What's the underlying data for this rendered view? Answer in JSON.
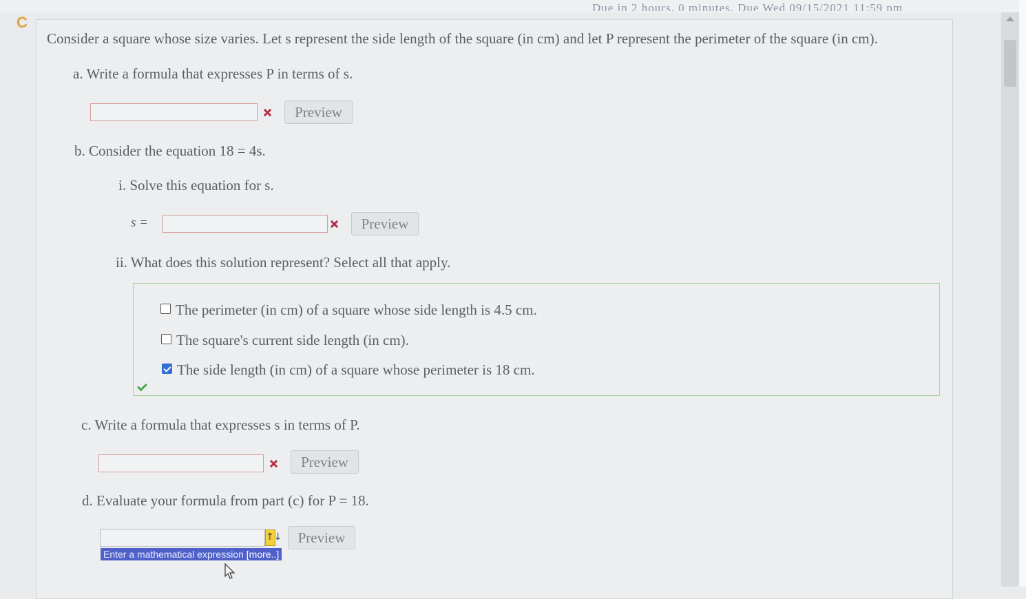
{
  "header": {
    "due_text": "Due in 2 hours, 0 minutes. Due Wed 09/15/2021 11:59 pm"
  },
  "intro": "Consider a square whose size varies. Let s represent the side length of the square (in cm) and let P represent the perimeter of the square (in cm).",
  "part_a": {
    "label": "a. Write a formula that expresses P in terms of s.",
    "value": "",
    "preview": "Preview"
  },
  "part_b": {
    "label": "b. Consider the equation 18 = 4s.",
    "i": {
      "label": "i. Solve this equation for s.",
      "prefix": "s =",
      "value": "",
      "preview": "Preview"
    },
    "ii": {
      "label": "ii. What does this solution represent? Select all that apply.",
      "options": [
        {
          "text": "The perimeter (in cm) of a square whose side length is 4.5 cm.",
          "checked": false
        },
        {
          "text": "The square's current side length (in cm).",
          "checked": false
        },
        {
          "text": "The side length (in cm) of a square whose perimeter is 18 cm.",
          "checked": true
        }
      ]
    }
  },
  "part_c": {
    "label": "c. Write a formula that expresses s in terms of P.",
    "value": "",
    "preview": "Preview"
  },
  "part_d": {
    "label": "d. Evaluate your formula from part (c) for P = 18.",
    "value": "",
    "preview": "Preview",
    "hint": "Enter a mathematical expression",
    "more": "[more..]",
    "updn_symbol": "↑↓"
  },
  "colors": {
    "error_mark": "#b5304a",
    "correct": "#4aa64a",
    "checkbox_checked": "#2f6fd6",
    "tooltip_bg": "#4f61c9"
  }
}
